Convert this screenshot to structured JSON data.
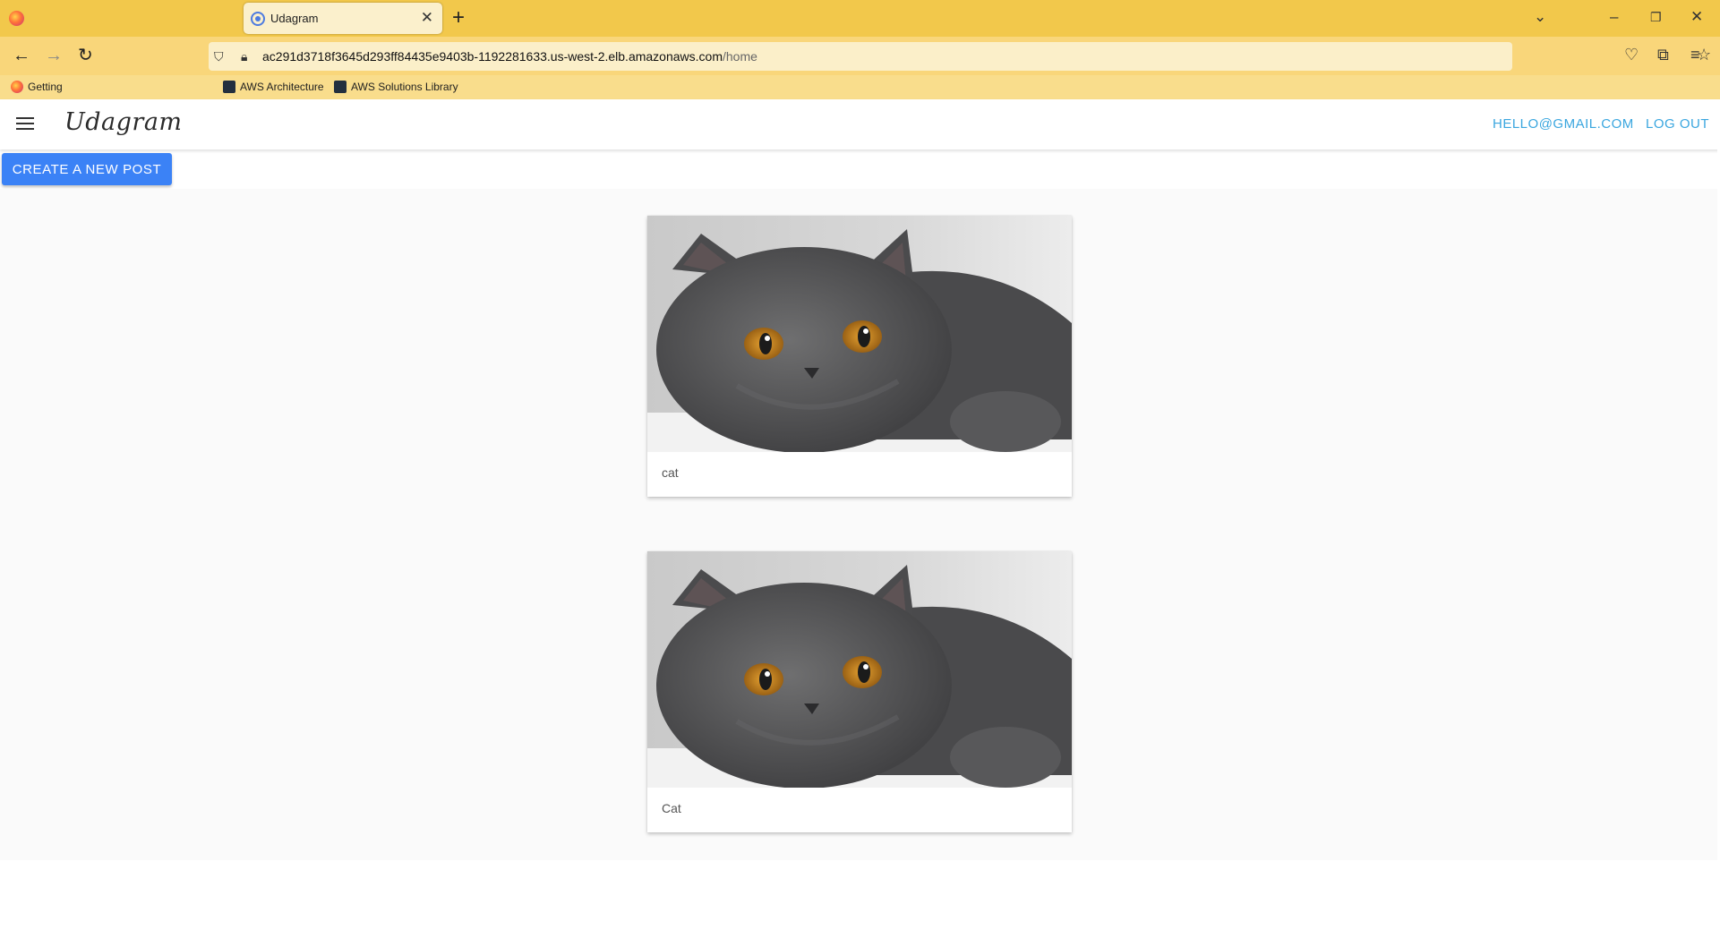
{
  "browser": {
    "tab_title": "Udagram",
    "url_host": "ac291d3718f3645d293ff84435e9403b-1192281633.us-west-2.elb.amazonaws.com",
    "url_path": "/home",
    "bookmarks": [
      "Getting",
      "AWS Architecture",
      "AWS Solutions Library"
    ],
    "icons": {
      "back": "arrow-left-icon",
      "forward": "arrow-right-icon",
      "reload": "reload-icon",
      "bookmark_star": "star-icon",
      "pocket": "pocket-icon",
      "extensions": "puzzle-icon",
      "menu": "menu-icon"
    }
  },
  "app": {
    "brand": "Udagram",
    "user_email": "HELLO@GMAIL.COM",
    "logout_label": "LOG OUT",
    "create_post_label": "CREATE A NEW POST"
  },
  "feed": {
    "posts": [
      {
        "caption": "cat"
      },
      {
        "caption": "Cat"
      }
    ]
  }
}
